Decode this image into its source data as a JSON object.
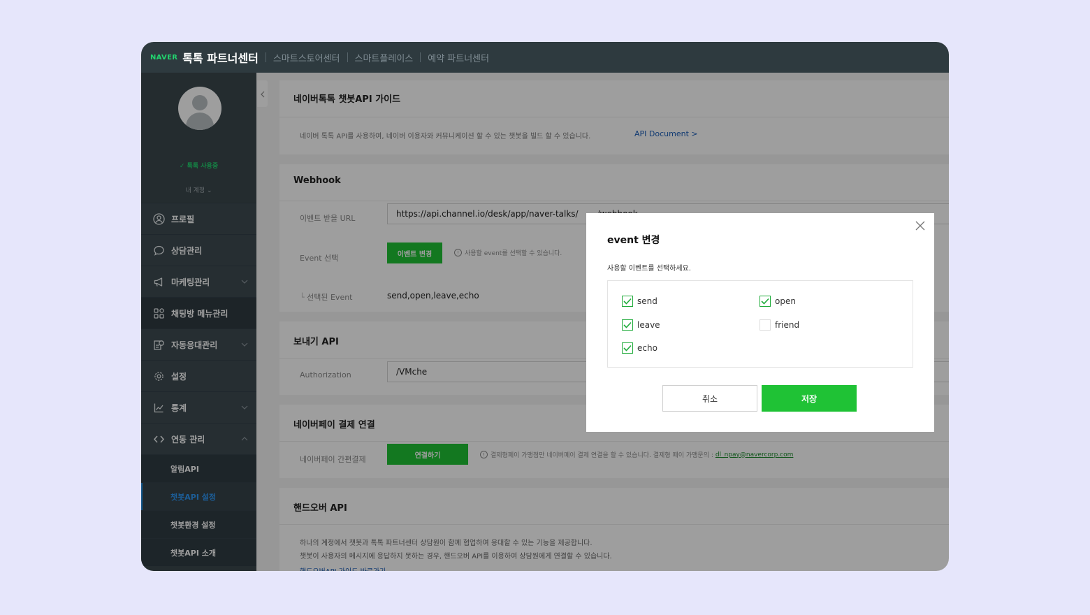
{
  "topbar": {
    "naver_logo": "NAVER",
    "brand_title": "톡톡 파트너센터",
    "links": [
      "스마트스토어센터",
      "스마트플레이스",
      "예약 파트너센터"
    ]
  },
  "sidebar": {
    "status": "톡톡 사용중",
    "account": "내 계정",
    "menu": [
      {
        "label": "프로필",
        "icon": "user-circle-icon",
        "chevron": false
      },
      {
        "label": "상담관리",
        "icon": "chat-bubble-icon",
        "chevron": false
      },
      {
        "label": "마케팅관리",
        "icon": "megaphone-icon",
        "chevron": true
      },
      {
        "label": "채팅방 메뉴관리",
        "icon": "grid-icon",
        "chevron": false
      },
      {
        "label": "자동응대관리",
        "icon": "auto-reply-icon",
        "chevron": true
      },
      {
        "label": "설정",
        "icon": "gear-icon",
        "chevron": false
      },
      {
        "label": "통계",
        "icon": "chart-icon",
        "chevron": true
      },
      {
        "label": "연동 관리",
        "icon": "code-icon",
        "chevron": true
      }
    ],
    "submenu": [
      "알림API",
      "챗봇API 설정",
      "챗봇환경 설정",
      "챗봇API 소개"
    ]
  },
  "guide": {
    "title": "네이버톡톡 챗봇API 가이드",
    "desc": "네이버 톡톡 API를 사용하여, 네이버 이용자와 커뮤니케이션 할 수 있는 챗봇을 빌드 할 수 있습니다.",
    "doc_link": "API Document >"
  },
  "webhook": {
    "title": "Webhook",
    "url_label": "이벤트 받을 URL",
    "url_value": "https://api.channel.io/desk/app/naver-talks/",
    "url_suffix": "/webhook",
    "event_label": "Event 선택",
    "event_button": "이벤트 변경",
    "event_hint": "사용할 event를 선택할 수 있습니다.",
    "selected_label": "선택된 Event",
    "selected_value": "send,open,leave,echo"
  },
  "send_api": {
    "title": "보내기 API",
    "auth_label": "Authorization",
    "auth_value": "/VMche"
  },
  "naverpay": {
    "title": "네이버페이 결제 연결",
    "label": "네이버페이 간편결제",
    "button": "연결하기",
    "hint": "결제형페이 가맹점만 네이버페이 결제 연결을 할 수 있습니다. 결제형 페이 가맹문의 :",
    "email": "dl_npay@navercorp.com"
  },
  "handover": {
    "title": "핸드오버 API",
    "line1": "하나의 계정에서 챗봇과 톡톡 파트너센터 상담원이 함께 협업하여 응대할 수 있는 기능을 제공합니다.",
    "line2": "챗봇이 사용자의 메시지에 응답하지 못하는 경우, 핸드오버 API를 이용하여 상담원에게 연결할 수 있습니다.",
    "link": "핸드오버API 가이드 바로가기"
  },
  "modal": {
    "title": "event 변경",
    "subtitle": "사용할 이벤트를 선택하세요.",
    "options": [
      {
        "label": "send",
        "checked": true
      },
      {
        "label": "open",
        "checked": true
      },
      {
        "label": "leave",
        "checked": true
      },
      {
        "label": "friend",
        "checked": false
      },
      {
        "label": "echo",
        "checked": true
      }
    ],
    "cancel": "취소",
    "save": "저장"
  },
  "colors": {
    "accent_green": "#1fc235",
    "naver_green": "#22d36e",
    "active_blue": "#2e97f4",
    "sidebar_bg": "#3a474d",
    "topbar_bg": "#2e3a3f"
  }
}
